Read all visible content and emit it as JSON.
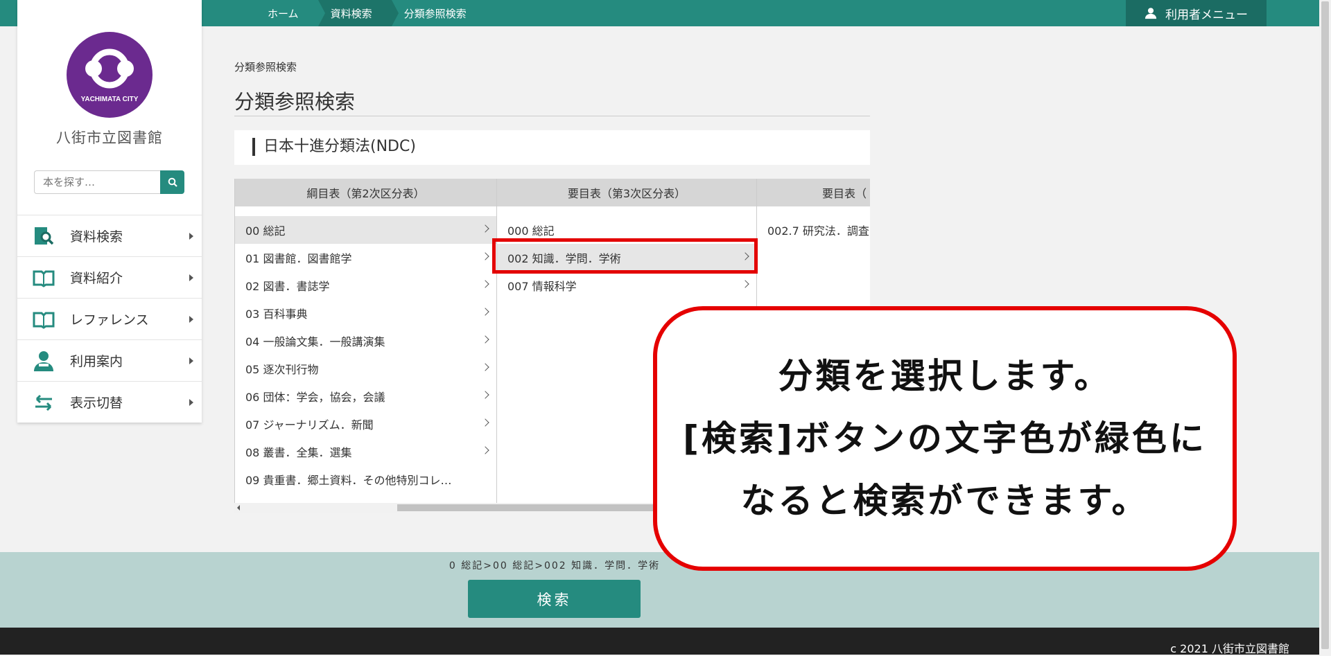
{
  "header": {
    "breadcrumbs": [
      "ホーム",
      "資料検索",
      "分類参照検索"
    ],
    "user_menu": "利用者メニュー"
  },
  "sidebar": {
    "logo_text": "YACHIMATA CITY",
    "library_name": "八街市立図書館",
    "search_placeholder": "本を探す…",
    "items": [
      {
        "label": "資料検索",
        "icon": "book-search-icon"
      },
      {
        "label": "資料紹介",
        "icon": "open-book-icon"
      },
      {
        "label": "レファレンス",
        "icon": "open-book-icon"
      },
      {
        "label": "利用案内",
        "icon": "person-icon"
      },
      {
        "label": "表示切替",
        "icon": "swap-arrows-icon"
      }
    ]
  },
  "main": {
    "breadcrumb": "分類参照検索",
    "title": "分類参照検索",
    "scheme": "日本十進分類法(NDC)",
    "columns": [
      {
        "header": "綱目表（第2次区分表）",
        "rows": [
          "00 総記",
          "01 図書館．図書館学",
          "02 図書．書誌学",
          "03 百科事典",
          "04 一般論文集．一般講演集",
          "05 逐次刊行物",
          "06 団体：学会，協会，会議",
          "07 ジャーナリズム．新聞",
          "08 叢書．全集．選集",
          "09 貴重書．郷土資料．その他特別コレ…"
        ]
      },
      {
        "header": "要目表（第3次区分表）",
        "rows": [
          "000 総記",
          "002 知識．学問．学術",
          "007 情報科学"
        ]
      },
      {
        "header": "要目表（",
        "rows": [
          "002.7 研究法．調査"
        ]
      }
    ]
  },
  "selection_path": "0 総記>00 総記>002 知識．学問．学術",
  "search_button": "検索",
  "footer": {
    "copyright": "c 2021 八街市立図書館"
  },
  "callout": {
    "line1": "分類を選択します。",
    "line2": "[検索]ボタンの文字色が緑色に",
    "line3": "なると検索ができます。"
  },
  "colors": {
    "brand": "#258b7f",
    "highlight": "#e30000",
    "bottom_bar": "#b8d3d0"
  }
}
